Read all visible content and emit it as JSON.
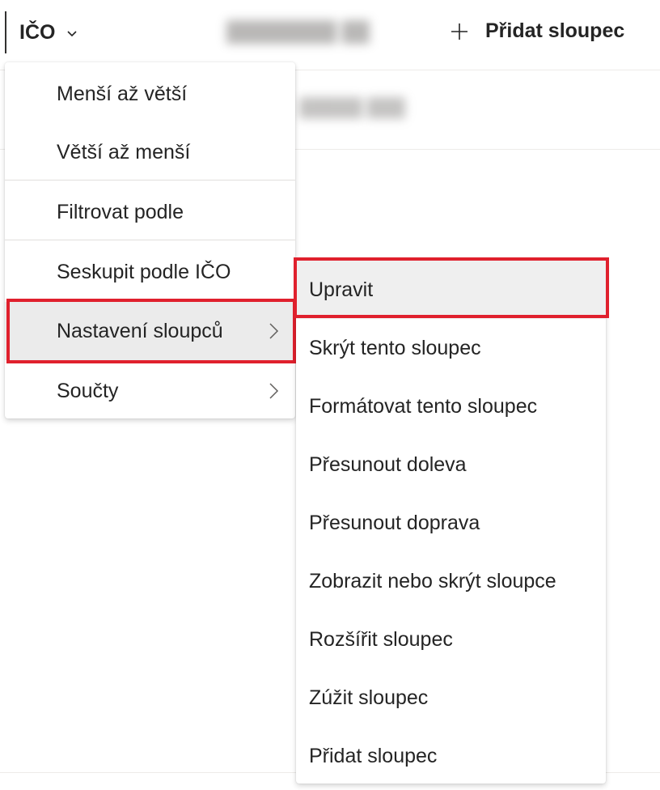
{
  "header": {
    "column_title": "IČO",
    "add_column_label": "Přidat sloupec"
  },
  "menu": {
    "items": [
      {
        "label": "Menší až větší"
      },
      {
        "label": "Větší až menší"
      },
      {
        "label": "Filtrovat podle"
      },
      {
        "label": "Seskupit podle IČO"
      },
      {
        "label": "Nastavení sloupců",
        "has_submenu": true,
        "highlighted": true
      },
      {
        "label": "Součty",
        "has_submenu": true
      }
    ]
  },
  "submenu": {
    "items": [
      {
        "label": "Upravit",
        "highlighted": true
      },
      {
        "label": "Skrýt tento sloupec"
      },
      {
        "label": "Formátovat tento sloupec"
      },
      {
        "label": "Přesunout doleva"
      },
      {
        "label": "Přesunout doprava"
      },
      {
        "label": "Zobrazit nebo skrýt sloupce"
      },
      {
        "label": "Rozšířit sloupec"
      },
      {
        "label": "Zúžit sloupec"
      },
      {
        "label": "Přidat sloupec"
      }
    ]
  },
  "colors": {
    "highlight_border": "#e0202d",
    "highlight_fill": "#ebebeb",
    "text": "#242424"
  }
}
